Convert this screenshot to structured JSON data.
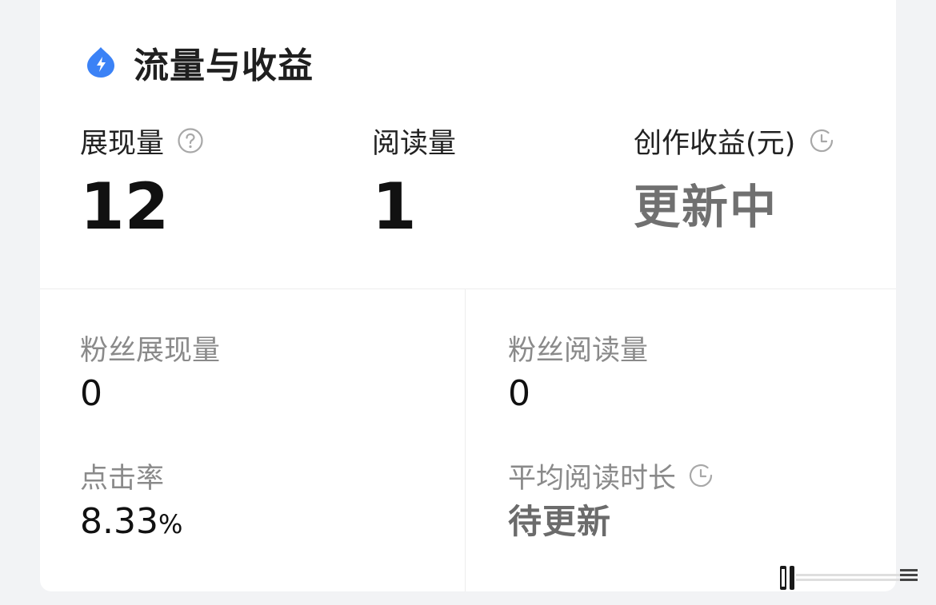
{
  "header": {
    "title": "流量与收益",
    "icon": "lightning-drop-icon",
    "accent_color": "#3b82f6"
  },
  "metrics": [
    {
      "label": "展现量",
      "value": "12",
      "icon": "help-circle-icon"
    },
    {
      "label": "阅读量",
      "value": "1"
    },
    {
      "label": "创作收益(元)",
      "value": "更新中",
      "icon": "clock-icon"
    }
  ],
  "stats": {
    "fans_impressions": {
      "label": "粉丝展现量",
      "value": "0"
    },
    "fans_reads": {
      "label": "粉丝阅读量",
      "value": "0"
    },
    "ctr": {
      "label": "点击率",
      "value": "8.33",
      "unit": "%"
    },
    "avg_read_time": {
      "label": "平均阅读时长",
      "value": "待更新",
      "icon": "clock-icon"
    }
  }
}
